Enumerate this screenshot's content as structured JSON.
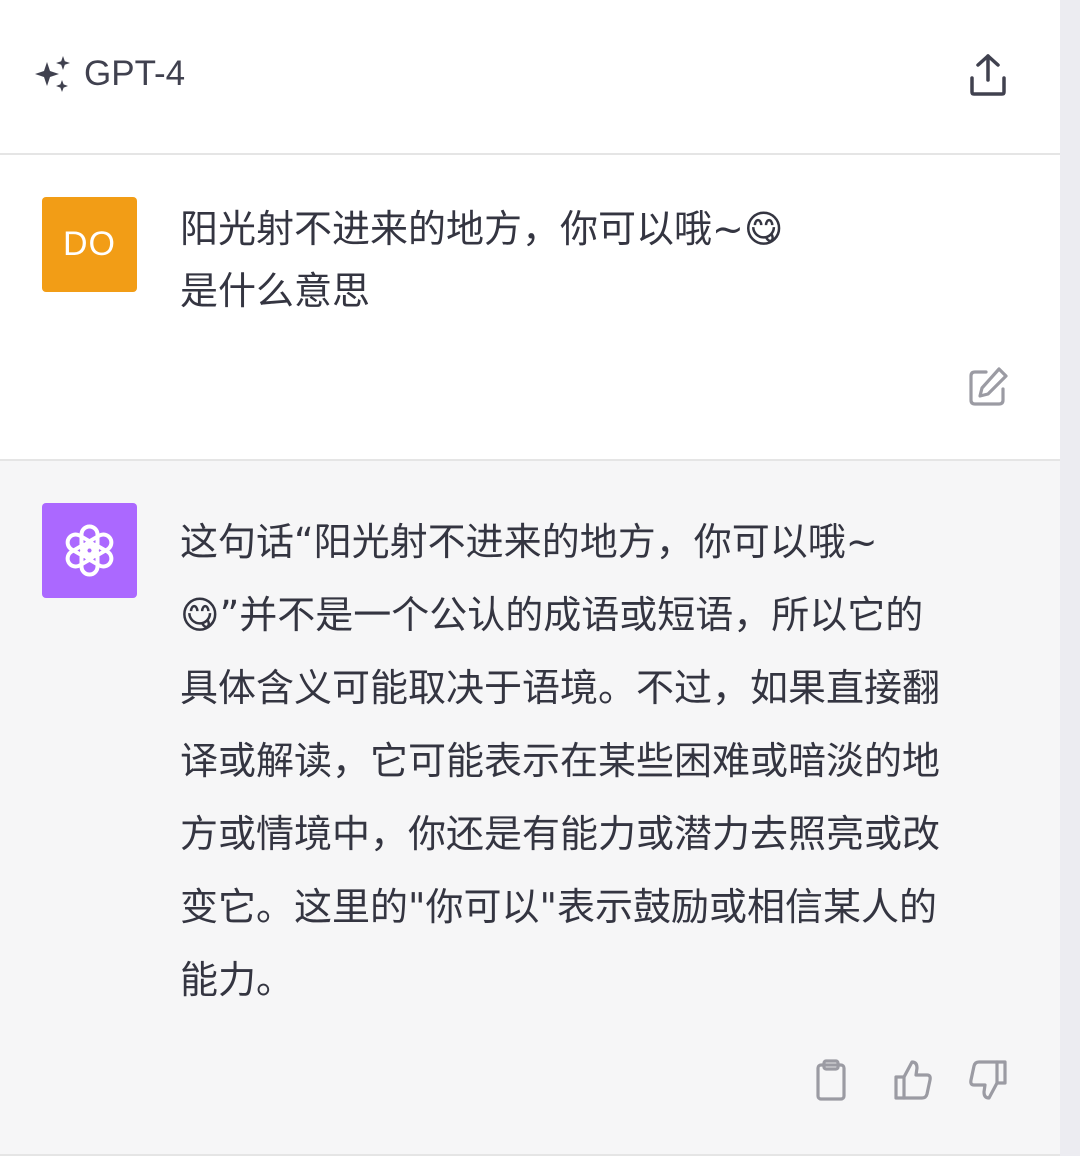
{
  "header": {
    "model_name": "GPT-4",
    "model_icon": "sparkles-icon",
    "share_icon": "share-icon"
  },
  "user_message": {
    "avatar_initials": "DO",
    "avatar_color": "#f29d16",
    "text": "阳光射不进来的地方，你可以哦~😋\n是什么意思",
    "edit_icon": "edit-icon"
  },
  "assistant_message": {
    "avatar_icon": "openai-logo-icon",
    "avatar_color": "#ab68ff",
    "lines": [
      "这句话“阳光射不进来的地方，你可以哦~",
      "😋”并不是一个公认的成语或短语，所以它的",
      "具体含义可能取决于语境。不过，如果直接翻",
      "译或解读，它可能表示在某些困难或暗淡的地",
      "方或情境中，你还是有能力或潜力去照亮或改",
      "变它。这里的\"你可以\"表示鼓励或相信某人的",
      "能力。"
    ],
    "actions": [
      "clipboard-icon",
      "thumbs-up-icon",
      "thumbs-down-icon"
    ]
  }
}
